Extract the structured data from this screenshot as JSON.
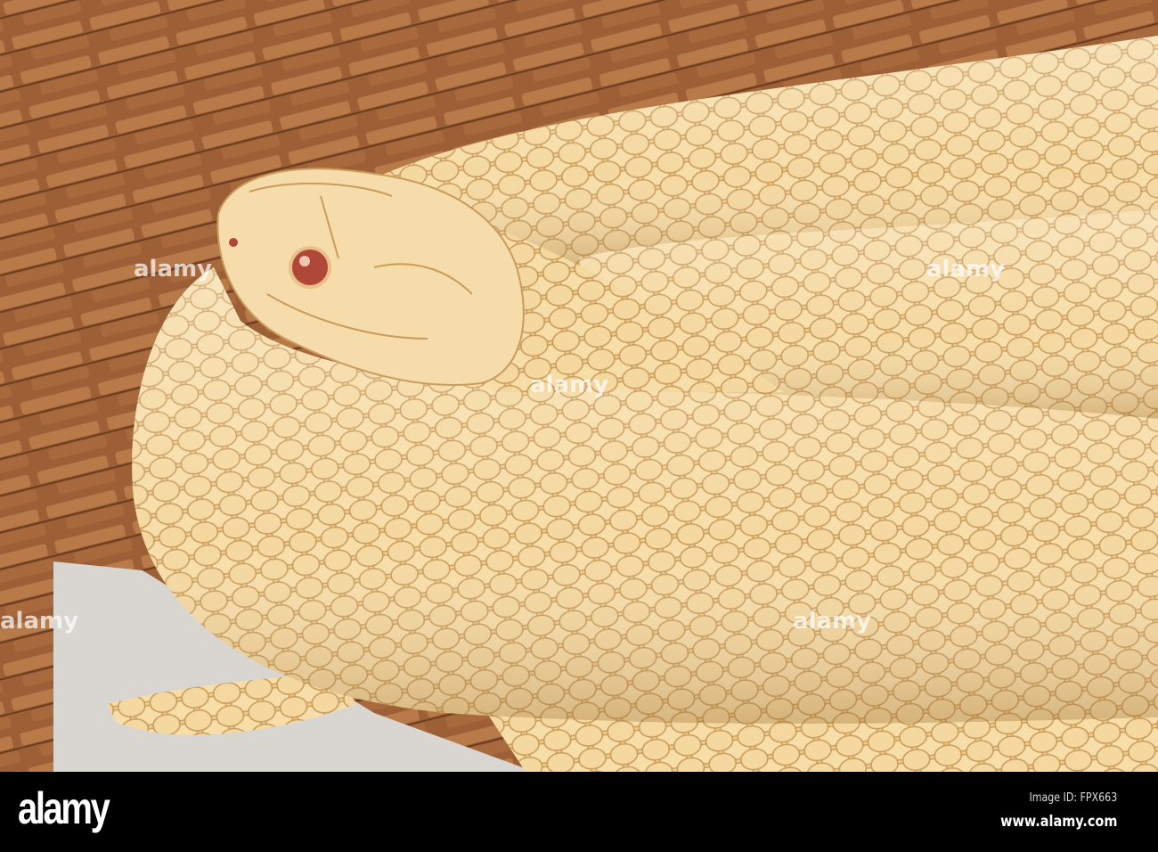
{
  "photo": {
    "subject": "albino snake coiled on wood chips",
    "colors": {
      "background_wood": "#a5683e",
      "snake_body": "#f3d49a",
      "snake_highlight": "#fbe8c0",
      "eye": "#b0483a",
      "floor": "#d9d6d2"
    }
  },
  "footer": {
    "logo": "alamy",
    "image_id": "Image ID: FPX663",
    "url": "www.alamy.com"
  },
  "watermark": "alamy"
}
